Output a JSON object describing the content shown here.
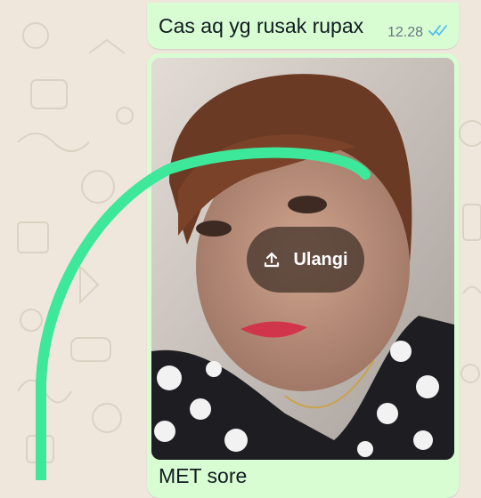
{
  "chat": {
    "messages": [
      {
        "type": "text",
        "text": "Cas aq yg rusak rupax",
        "time": "12.28",
        "status_icon": "double-check-read-icon"
      },
      {
        "type": "image",
        "retry_label": "Ulangi",
        "retry_icon": "upload-icon",
        "caption": "MET sore"
      }
    ]
  },
  "colors": {
    "wallpaper": "#efe7dc",
    "outgoing_bubble": "#d9fdd3",
    "read_ticks": "#53bdeb",
    "drawing_stroke": "#3ee89a"
  }
}
